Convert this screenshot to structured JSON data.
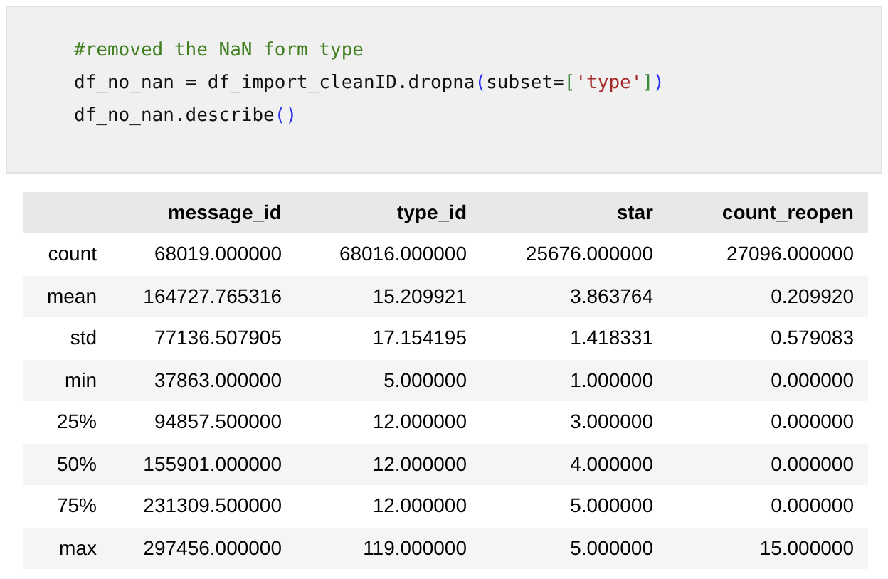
{
  "code_cell": {
    "lines": [
      [
        {
          "kind": "comment",
          "text": "#removed the NaN form type"
        }
      ],
      [
        {
          "kind": "plain",
          "text": "df_no_nan = df_import_cleanID.dropna"
        },
        {
          "kind": "paren",
          "text": "("
        },
        {
          "kind": "plain",
          "text": "subset="
        },
        {
          "kind": "bracket",
          "text": "["
        },
        {
          "kind": "string",
          "text": "'type'"
        },
        {
          "kind": "bracket",
          "text": "]"
        },
        {
          "kind": "paren",
          "text": ")"
        }
      ],
      [
        {
          "kind": "plain",
          "text": "df_no_nan.describe"
        },
        {
          "kind": "paren",
          "text": "()"
        }
      ]
    ]
  },
  "table": {
    "columns": [
      "message_id",
      "type_id",
      "star",
      "count_reopen"
    ],
    "rows": [
      {
        "label": "count",
        "cells": [
          "68019.000000",
          "68016.000000",
          "25676.000000",
          "27096.000000"
        ]
      },
      {
        "label": "mean",
        "cells": [
          "164727.765316",
          "15.209921",
          "3.863764",
          "0.209920"
        ]
      },
      {
        "label": "std",
        "cells": [
          "77136.507905",
          "17.154195",
          "1.418331",
          "0.579083"
        ]
      },
      {
        "label": "min",
        "cells": [
          "37863.000000",
          "5.000000",
          "1.000000",
          "0.000000"
        ]
      },
      {
        "label": "25%",
        "cells": [
          "94857.500000",
          "12.000000",
          "3.000000",
          "0.000000"
        ]
      },
      {
        "label": "50%",
        "cells": [
          "155901.000000",
          "12.000000",
          "4.000000",
          "0.000000"
        ]
      },
      {
        "label": "75%",
        "cells": [
          "231309.500000",
          "12.000000",
          "5.000000",
          "0.000000"
        ]
      },
      {
        "label": "max",
        "cells": [
          "297456.000000",
          "119.000000",
          "5.000000",
          "15.000000"
        ]
      }
    ]
  }
}
